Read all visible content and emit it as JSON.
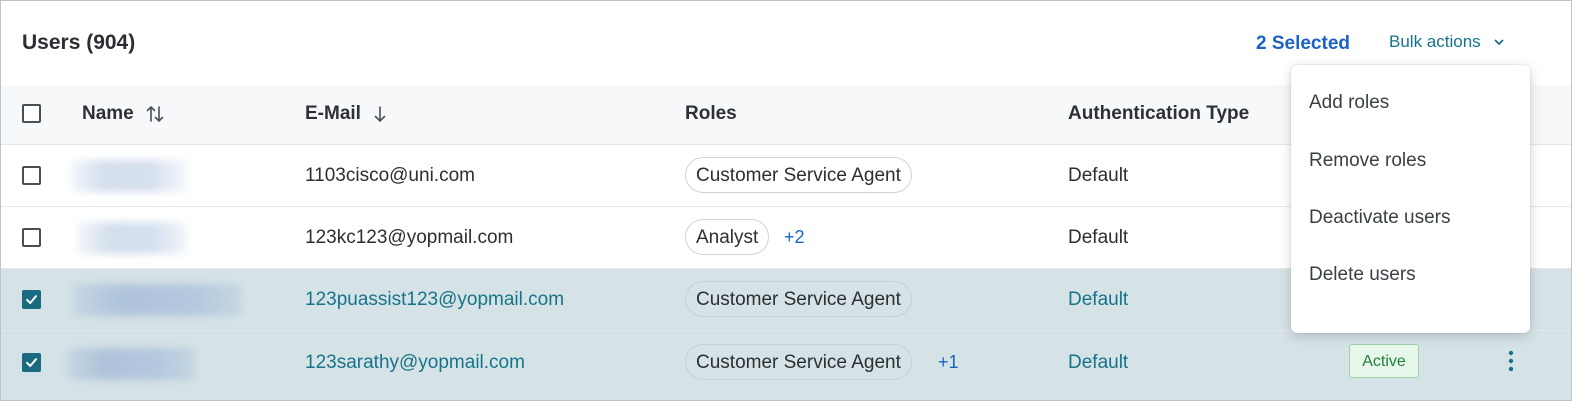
{
  "header": {
    "title": "Users (904)",
    "selected_count": "2 Selected",
    "bulk_actions_label": "Bulk actions"
  },
  "columns": {
    "name": "Name",
    "email": "E-Mail",
    "roles": "Roles",
    "auth": "Authentication Type"
  },
  "rows": [
    {
      "email": "1103cisco@uni.com",
      "role": "Customer Service Agent",
      "more": "",
      "auth": "Default",
      "checked": false,
      "status": ""
    },
    {
      "email": "123kc123@yopmail.com",
      "role": "Analyst",
      "more": "+2",
      "auth": "Default",
      "checked": true,
      "status": ""
    },
    {
      "email": "123puassist123@yopmail.com",
      "role": "Customer Service Agent",
      "more": "",
      "auth": "Default",
      "checked": true,
      "status": ""
    },
    {
      "email": "123sarathy@yopmail.com",
      "role": "Customer Service Agent",
      "more": "+1",
      "auth": "Default",
      "checked": true,
      "status": "Active"
    }
  ],
  "bulk_menu": {
    "items": [
      "Add roles",
      "Remove roles",
      "Deactivate users",
      "Delete users"
    ]
  },
  "colors": {
    "accent": "#16748a",
    "selected_text": "#1b62c4",
    "selected_row": "#d6e3e6",
    "active_badge": "#23803a"
  },
  "icons": {
    "sort_name": "sort-both-icon",
    "sort_email": "arrow-down-icon",
    "bulk_chevron": "chevron-down-icon",
    "row_menu": "kebab-vertical-icon"
  }
}
